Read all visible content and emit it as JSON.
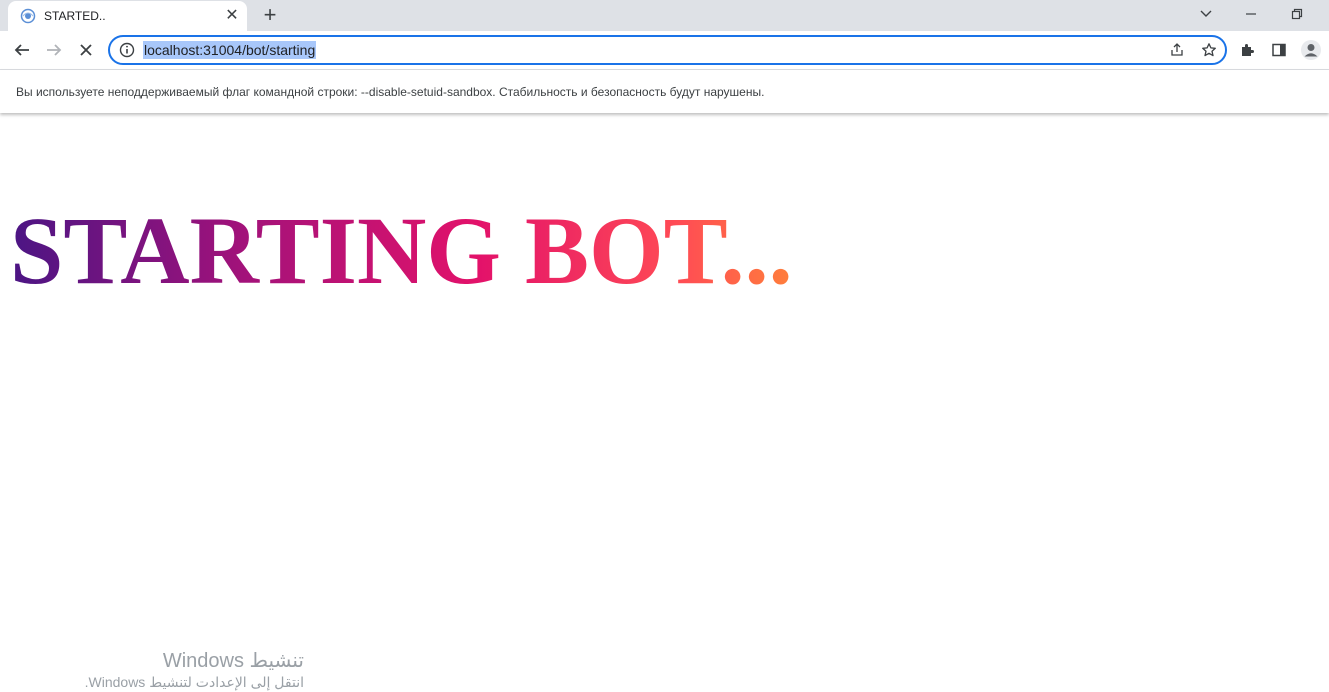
{
  "browser": {
    "tab": {
      "title": "STARTED..",
      "close_glyph": "✕",
      "favicon": "globe-icon"
    },
    "new_tab_glyph": "+",
    "window_controls": [
      "tab-search-icon",
      "minimize-icon",
      "restore-icon"
    ],
    "url": "localhost:31004/bot/starting",
    "toolbar_icons": [
      "back-arrow-icon",
      "forward-arrow-icon",
      "stop-loading-icon",
      "info-icon",
      "share-icon",
      "bookmark-star-icon",
      "extensions-puzzle-icon",
      "side-panel-icon",
      "profile-avatar-icon"
    ],
    "infobar_text": "Вы используете неподдерживаемый флаг командной строки: --disable-setuid-sandbox. Стабильность и безопасность будут нарушены."
  },
  "page": {
    "heading": "STARTING BOT..."
  },
  "watermark": {
    "title": "تنشيط Windows",
    "subtitle": "انتقل إلى الإعدادت لتنشيط Windows."
  },
  "colors": {
    "accent": "#1a73e8",
    "gradient_start": "#4b1584",
    "gradient_end": "#ff7f3b"
  }
}
